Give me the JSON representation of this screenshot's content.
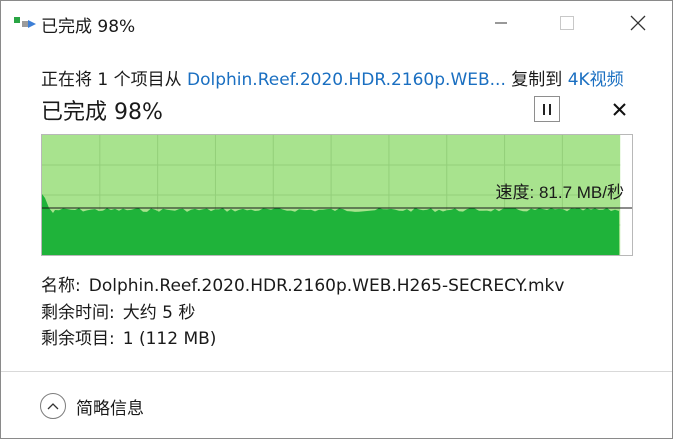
{
  "window": {
    "title": "已完成 98%",
    "controls": {
      "minimize": "minimize",
      "maximize": "maximize",
      "close": "close"
    }
  },
  "copy_line": {
    "prefix": "正在将 1 个项目从 ",
    "source": "Dolphin.Reef.2020.HDR.2160p.WEB...",
    "middle": " 复制到 ",
    "destination": "4K视频"
  },
  "progress": {
    "heading": "已完成 98%",
    "percent": 98,
    "speed_text": "速度: 81.7 MB/秒"
  },
  "details": {
    "name_label": "名称:",
    "name_value": "Dolphin.Reef.2020.HDR.2160p.WEB.H265-SECRECY.mkv",
    "time_label": "剩余时间:",
    "time_value": "大约 5 秒",
    "items_label": "剩余项目:",
    "items_value": "1 (112 MB)"
  },
  "footer": {
    "more_info": "简略信息"
  },
  "colors": {
    "accent_link": "#1a6fc1",
    "chart_bg": "#a8e38e",
    "chart_fill": "#1fb33a",
    "chart_grid": "#93cf7a",
    "chart_border": "#b8b8b8"
  },
  "icons": {
    "app": "copy-files-icon",
    "pause": "pause-icon",
    "cancel": "close-icon",
    "more": "chevron-up-icon"
  }
}
